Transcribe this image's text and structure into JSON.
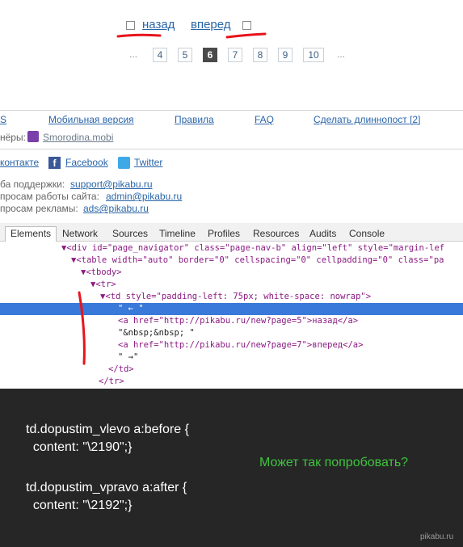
{
  "pager": {
    "prev_label": "назад",
    "next_label": "вперед",
    "ellipsis": "...",
    "pages": [
      "4",
      "5",
      "6",
      "7",
      "8",
      "9",
      "10"
    ],
    "current_page": "6"
  },
  "footer_links": {
    "partial": "S",
    "mobile": "Мобильная версия",
    "rules": "Правила",
    "faq": "FAQ",
    "longpost": "Сделать длиннопост",
    "longpost_count": "[2]"
  },
  "partners": {
    "label_partial": "нёры:",
    "site": "Smorodina.mobi"
  },
  "social": {
    "vk_partial": "контакте",
    "facebook": "Facebook",
    "twitter": "Twitter"
  },
  "contacts": [
    {
      "label": "ба поддержки:",
      "email": "support@pikabu.ru"
    },
    {
      "label": "просам работы сайта:",
      "email": "admin@pikabu.ru"
    },
    {
      "label": "просам рекламы:",
      "email": "ads@pikabu.ru"
    }
  ],
  "devtools": {
    "tabs": [
      "Elements",
      "Network",
      "Sources",
      "Timeline",
      "Profiles",
      "Resources",
      "Audits",
      "Console"
    ],
    "active_tab": "Elements",
    "lines": {
      "l1": "▼<div id=\"page_navigator\" class=\"page-nav-b\" align=\"left\" style=\"margin-lef",
      "l2": "▼<table width=\"auto\" border=\"0\" cellspacing=\"0\" cellpadding=\"0\" class=\"pa",
      "l3": "▼<tbody>",
      "l4": "▼<tr>",
      "l5": "▼<td style=\"padding-left: 75px; white-space: nowrap\">",
      "l6": "\" ← \"",
      "l7": "<a href=\"http://pikabu.ru/new?page=5\">назад</a>",
      "l8": "\"&nbsp;&nbsp; \"",
      "l9": "<a href=\"http://pikabu.ru/new?page=7\">вперед</a>",
      "l10": "\" →\"",
      "l11": "</td>",
      "l12": "</tr>"
    }
  },
  "css_snippet": {
    "line1": "td.dopustim_vlevo a:before {",
    "line2": "  content: \"\\2190\";}",
    "line3": "td.dopustim_vpravo a:after {",
    "line4": "  content: \"\\2192\";}"
  },
  "comment": "Может так попробовать?",
  "watermark": "pikabu.ru",
  "colors": {
    "link": "#2a65a8",
    "annotation_red": "#e8141c",
    "selection": "#3879d9",
    "comment_green": "#3ec43e",
    "dark_bg": "#262626"
  }
}
